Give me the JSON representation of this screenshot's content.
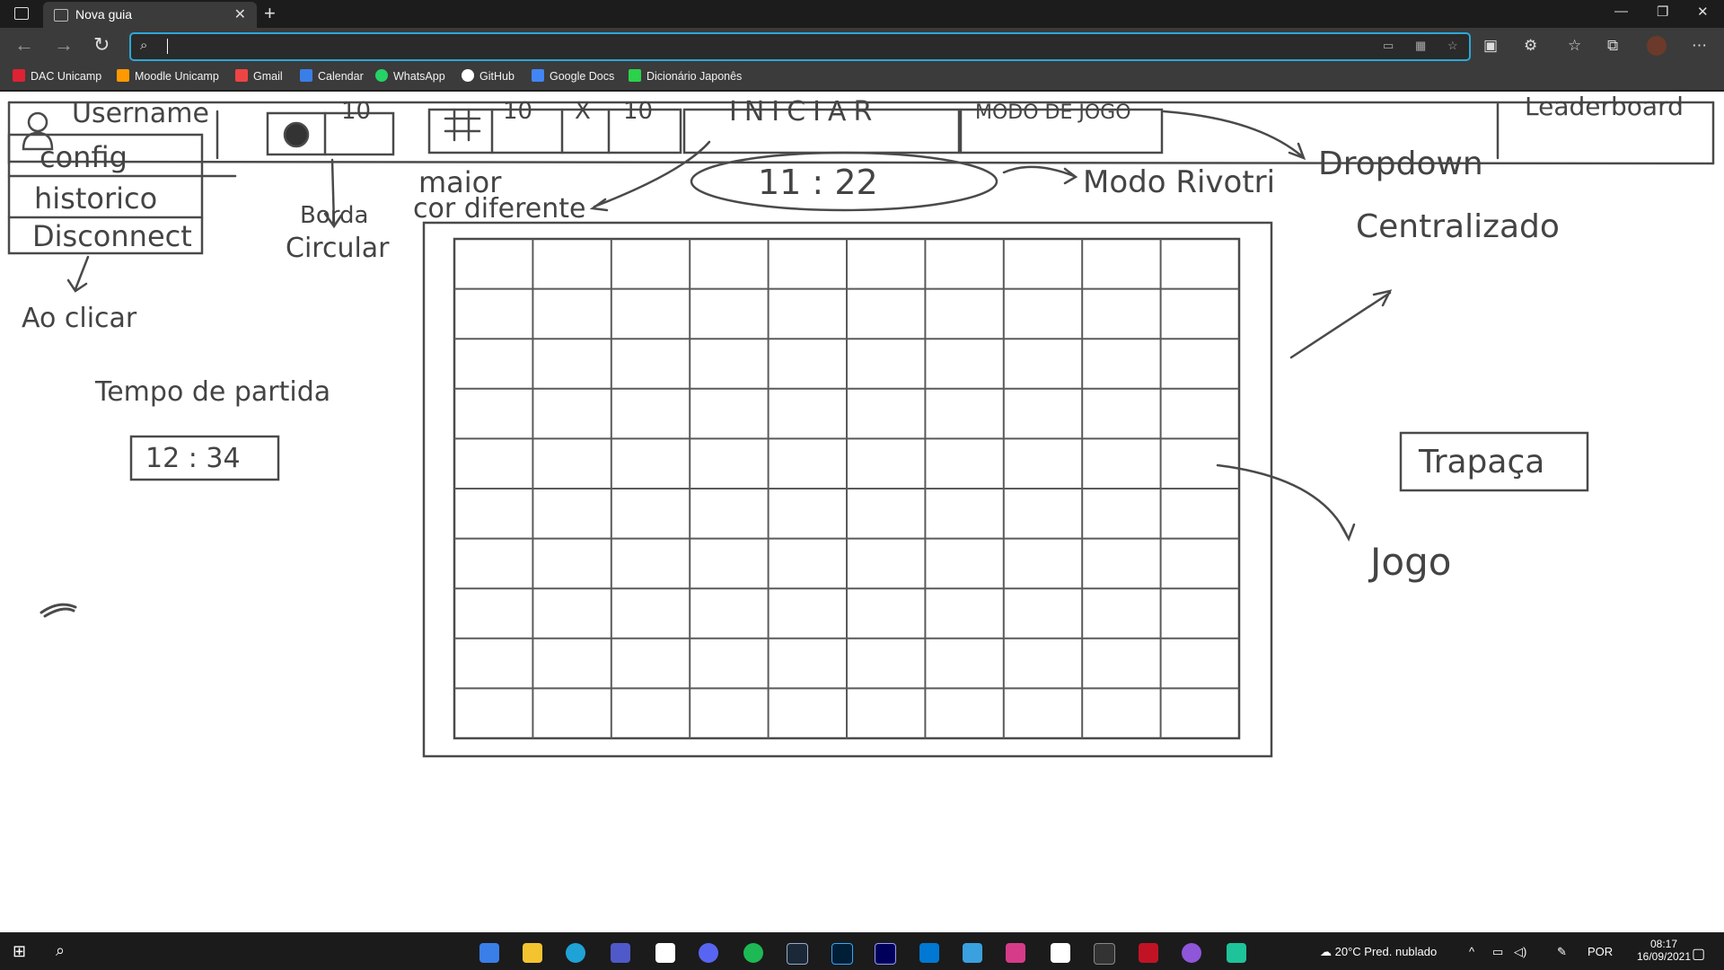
{
  "browser": {
    "tab_title": "Nova guia",
    "address_value": "",
    "bookmarks": [
      {
        "label": "DAC Unicamp",
        "color": "#d23"
      },
      {
        "label": "Moodle Unicamp",
        "color": "#f90"
      },
      {
        "label": "Gmail",
        "color": "#e44"
      },
      {
        "label": "Calendar",
        "color": "#3a7ee8"
      },
      {
        "label": "WhatsApp",
        "color": "#25d366"
      },
      {
        "label": "GitHub",
        "color": "#ffffff"
      },
      {
        "label": "Google Docs",
        "color": "#4285f4"
      },
      {
        "label": "Dicionário Japonês",
        "color": "#2bd24a"
      }
    ]
  },
  "sketch": {
    "header": {
      "username": "Username",
      "bomb_count": "10",
      "grid_w": "10",
      "grid_x": "X",
      "grid_h": "10",
      "start": "INICIAR",
      "mode": "MODO DE JOGO",
      "leaderboard": "Leaderboard"
    },
    "menu": [
      "config",
      "historico",
      "Disconnect"
    ],
    "notes": {
      "ao_clicar": "Ao clicar",
      "borda_1": "Borda",
      "borda_2": "Circular",
      "maior_1": "maior",
      "maior_2": "cor diferente",
      "modo_rivotri": "Modo Rivotri",
      "dropdown": "Dropdown",
      "centralizado": "Centralizado",
      "jogo": "Jogo",
      "tempo_partida": "Tempo de partida"
    },
    "timer_big": "11 : 22",
    "timer_small": "12 : 34",
    "trapaca": "Trapaça",
    "grid": {
      "rows": 10,
      "cols": 10
    }
  },
  "taskbar": {
    "weather": "20°C  Pred. nublado",
    "lang": "POR",
    "time": "08:17",
    "date": "16/09/2021"
  }
}
